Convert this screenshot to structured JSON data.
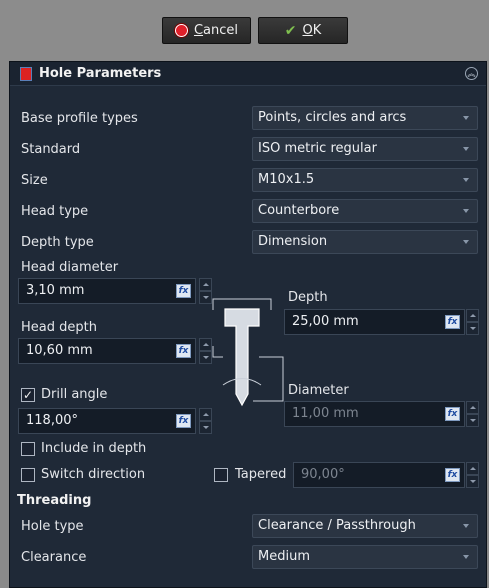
{
  "dialog": {
    "cancel_label": "Cancel",
    "ok_label": "OK"
  },
  "panel": {
    "title": "Hole Parameters",
    "collapse_icon": "collapse-up-icon"
  },
  "fields": {
    "base_profile": {
      "label": "Base profile types",
      "value": "Points, circles and arcs"
    },
    "standard": {
      "label": "Standard",
      "value": "ISO metric regular"
    },
    "size": {
      "label": "Size",
      "value": "M10x1.5"
    },
    "head_type": {
      "label": "Head type",
      "value": "Counterbore"
    },
    "depth_type": {
      "label": "Depth type",
      "value": "Dimension"
    }
  },
  "dimensions": {
    "head_diameter": {
      "label": "Head diameter",
      "value": "3,10 mm"
    },
    "head_depth": {
      "label": "Head depth",
      "value": "10,60 mm"
    },
    "depth": {
      "label": "Depth",
      "value": "25,00 mm"
    },
    "drill_angle": {
      "label": "Drill angle",
      "value": "118,00°",
      "checked": true
    },
    "diameter": {
      "label": "Diameter",
      "value": "11,00 mm",
      "enabled": false
    },
    "tapered_angle": {
      "value": "90,00°",
      "enabled": false
    }
  },
  "options": {
    "include_in_depth": {
      "label": "Include in depth",
      "checked": false
    },
    "switch_direction": {
      "label": "Switch direction",
      "checked": false
    },
    "tapered": {
      "label": "Tapered",
      "checked": false
    }
  },
  "threading": {
    "section_title": "Threading",
    "hole_type": {
      "label": "Hole type",
      "value": "Clearance / Passthrough"
    },
    "clearance": {
      "label": "Clearance",
      "value": "Medium"
    }
  },
  "icons": {
    "cancel": "cancel-icon",
    "ok": "ok-check-icon",
    "formula": "fx-formula-icon"
  },
  "colors": {
    "panel_bg": "#1f2937",
    "cancel_red": "#e0202a",
    "ok_green": "#7fbf4f"
  }
}
